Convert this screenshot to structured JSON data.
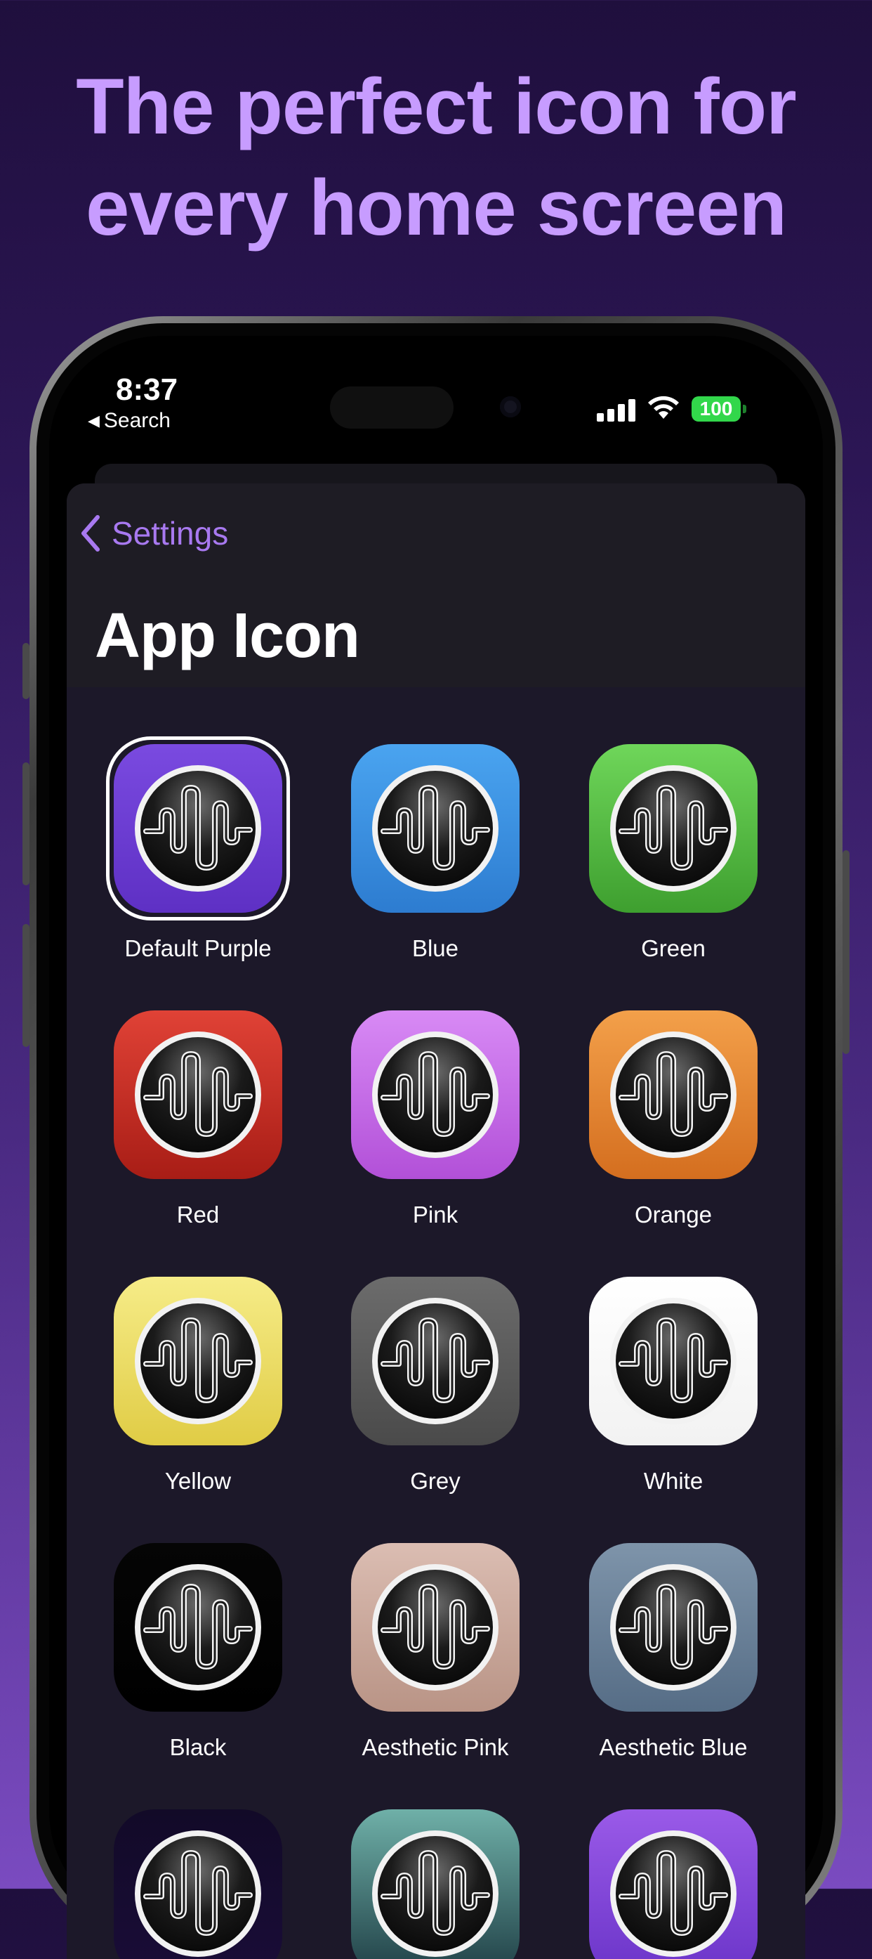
{
  "headline": {
    "line1": "The perfect icon for",
    "line2": "every home screen"
  },
  "status_bar": {
    "time": "8:37",
    "back_label": "Search",
    "battery": "100"
  },
  "nav": {
    "back_label": "Settings",
    "title": "App Icon"
  },
  "icons": [
    {
      "label": "Default Purple",
      "color_top": "#7a4ae0",
      "color_bottom": "#5e30c4",
      "selected": true
    },
    {
      "label": "Blue",
      "color_top": "#4aa4f0",
      "color_bottom": "#2d7cd0",
      "selected": false
    },
    {
      "label": "Green",
      "color_top": "#6fd65a",
      "color_bottom": "#3e9f2f",
      "selected": false
    },
    {
      "label": "Red",
      "color_top": "#e04236",
      "color_bottom": "#a81d16",
      "selected": false
    },
    {
      "label": "Pink",
      "color_top": "#d88af5",
      "color_bottom": "#b250d8",
      "selected": false
    },
    {
      "label": "Orange",
      "color_top": "#f3a04a",
      "color_bottom": "#d46e1f",
      "selected": false
    },
    {
      "label": "Yellow",
      "color_top": "#f6ec88",
      "color_bottom": "#e0cc45",
      "selected": false
    },
    {
      "label": "Grey",
      "color_top": "#6c6c6c",
      "color_bottom": "#4a4a4a",
      "selected": false
    },
    {
      "label": "White",
      "color_top": "#ffffff",
      "color_bottom": "#f2f2f2",
      "selected": false
    },
    {
      "label": "Black",
      "color_top": "#050505",
      "color_bottom": "#000000",
      "selected": false
    },
    {
      "label": "Aesthetic Pink",
      "color_top": "#dbbdb2",
      "color_bottom": "#b99486",
      "selected": false
    },
    {
      "label": "Aesthetic Blue",
      "color_top": "#7e94aa",
      "color_bottom": "#566d86",
      "selected": false
    },
    {
      "label": "",
      "color_top": "#120a28",
      "color_bottom": "#1a0d38",
      "selected": false
    },
    {
      "label": "",
      "color_top": "#6fb0a8",
      "color_bottom": "#1e3d44",
      "selected": false
    },
    {
      "label": "",
      "color_top": "#9a5ae8",
      "color_bottom": "#6a34c8",
      "selected": false
    }
  ],
  "colors": {
    "headline": "#c79cff",
    "accent": "#a879f0",
    "sheet_background": "#1c1829"
  }
}
